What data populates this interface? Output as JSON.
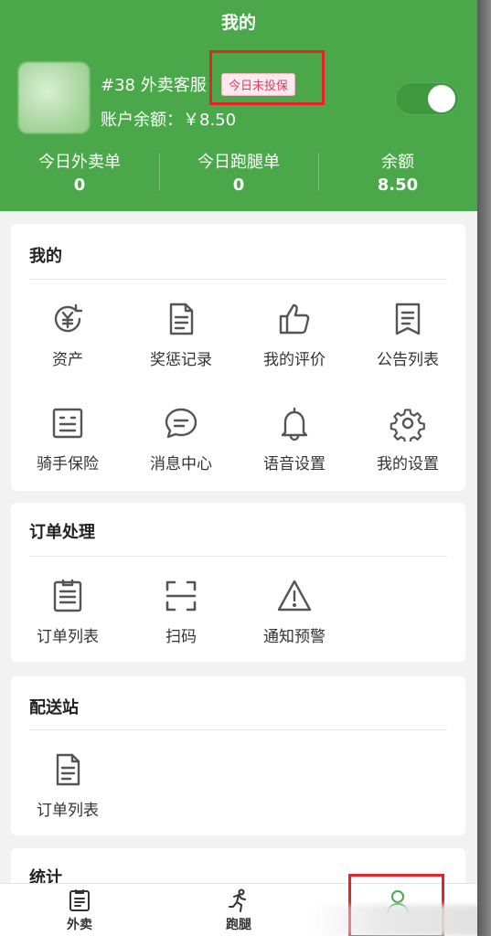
{
  "header": {
    "title": "我的",
    "shop_name": "#38 外卖客服",
    "insurance_badge": "今日未投保",
    "balance_text": "账户余额：￥8.50",
    "online_toggle": true
  },
  "stats": [
    {
      "label": "今日外卖单",
      "value": "0"
    },
    {
      "label": "今日跑腿单",
      "value": "0"
    },
    {
      "label": "余额",
      "value": "8.50"
    }
  ],
  "sections": {
    "mine": {
      "title": "我的",
      "items": [
        {
          "label": "资产",
          "icon": "yen-refresh-icon"
        },
        {
          "label": "奖惩记录",
          "icon": "document-icon"
        },
        {
          "label": "我的评价",
          "icon": "thumbs-up-icon"
        },
        {
          "label": "公告列表",
          "icon": "notice-list-icon"
        },
        {
          "label": "骑手保险",
          "icon": "insurance-icon"
        },
        {
          "label": "消息中心",
          "icon": "chat-bubble-icon"
        },
        {
          "label": "语音设置",
          "icon": "bell-icon"
        },
        {
          "label": "我的设置",
          "icon": "gear-icon"
        }
      ]
    },
    "orders": {
      "title": "订单处理",
      "items": [
        {
          "label": "订单列表",
          "icon": "clipboard-list-icon"
        },
        {
          "label": "扫码",
          "icon": "scan-icon"
        },
        {
          "label": "通知预警",
          "icon": "warning-icon"
        }
      ]
    },
    "station": {
      "title": "配送站",
      "items": [
        {
          "label": "订单列表",
          "icon": "document-icon"
        }
      ]
    },
    "stats": {
      "title": "统计"
    }
  },
  "tabbar": [
    {
      "label": "外卖",
      "icon": "takeout-list-icon"
    },
    {
      "label": "跑腿",
      "icon": "runner-icon"
    },
    {
      "label": "",
      "icon": "user-icon",
      "active": true
    }
  ],
  "colors": {
    "brand_green": "#4aa84a",
    "badge_text": "#e63b5f",
    "highlight_red": "#e8212b"
  }
}
